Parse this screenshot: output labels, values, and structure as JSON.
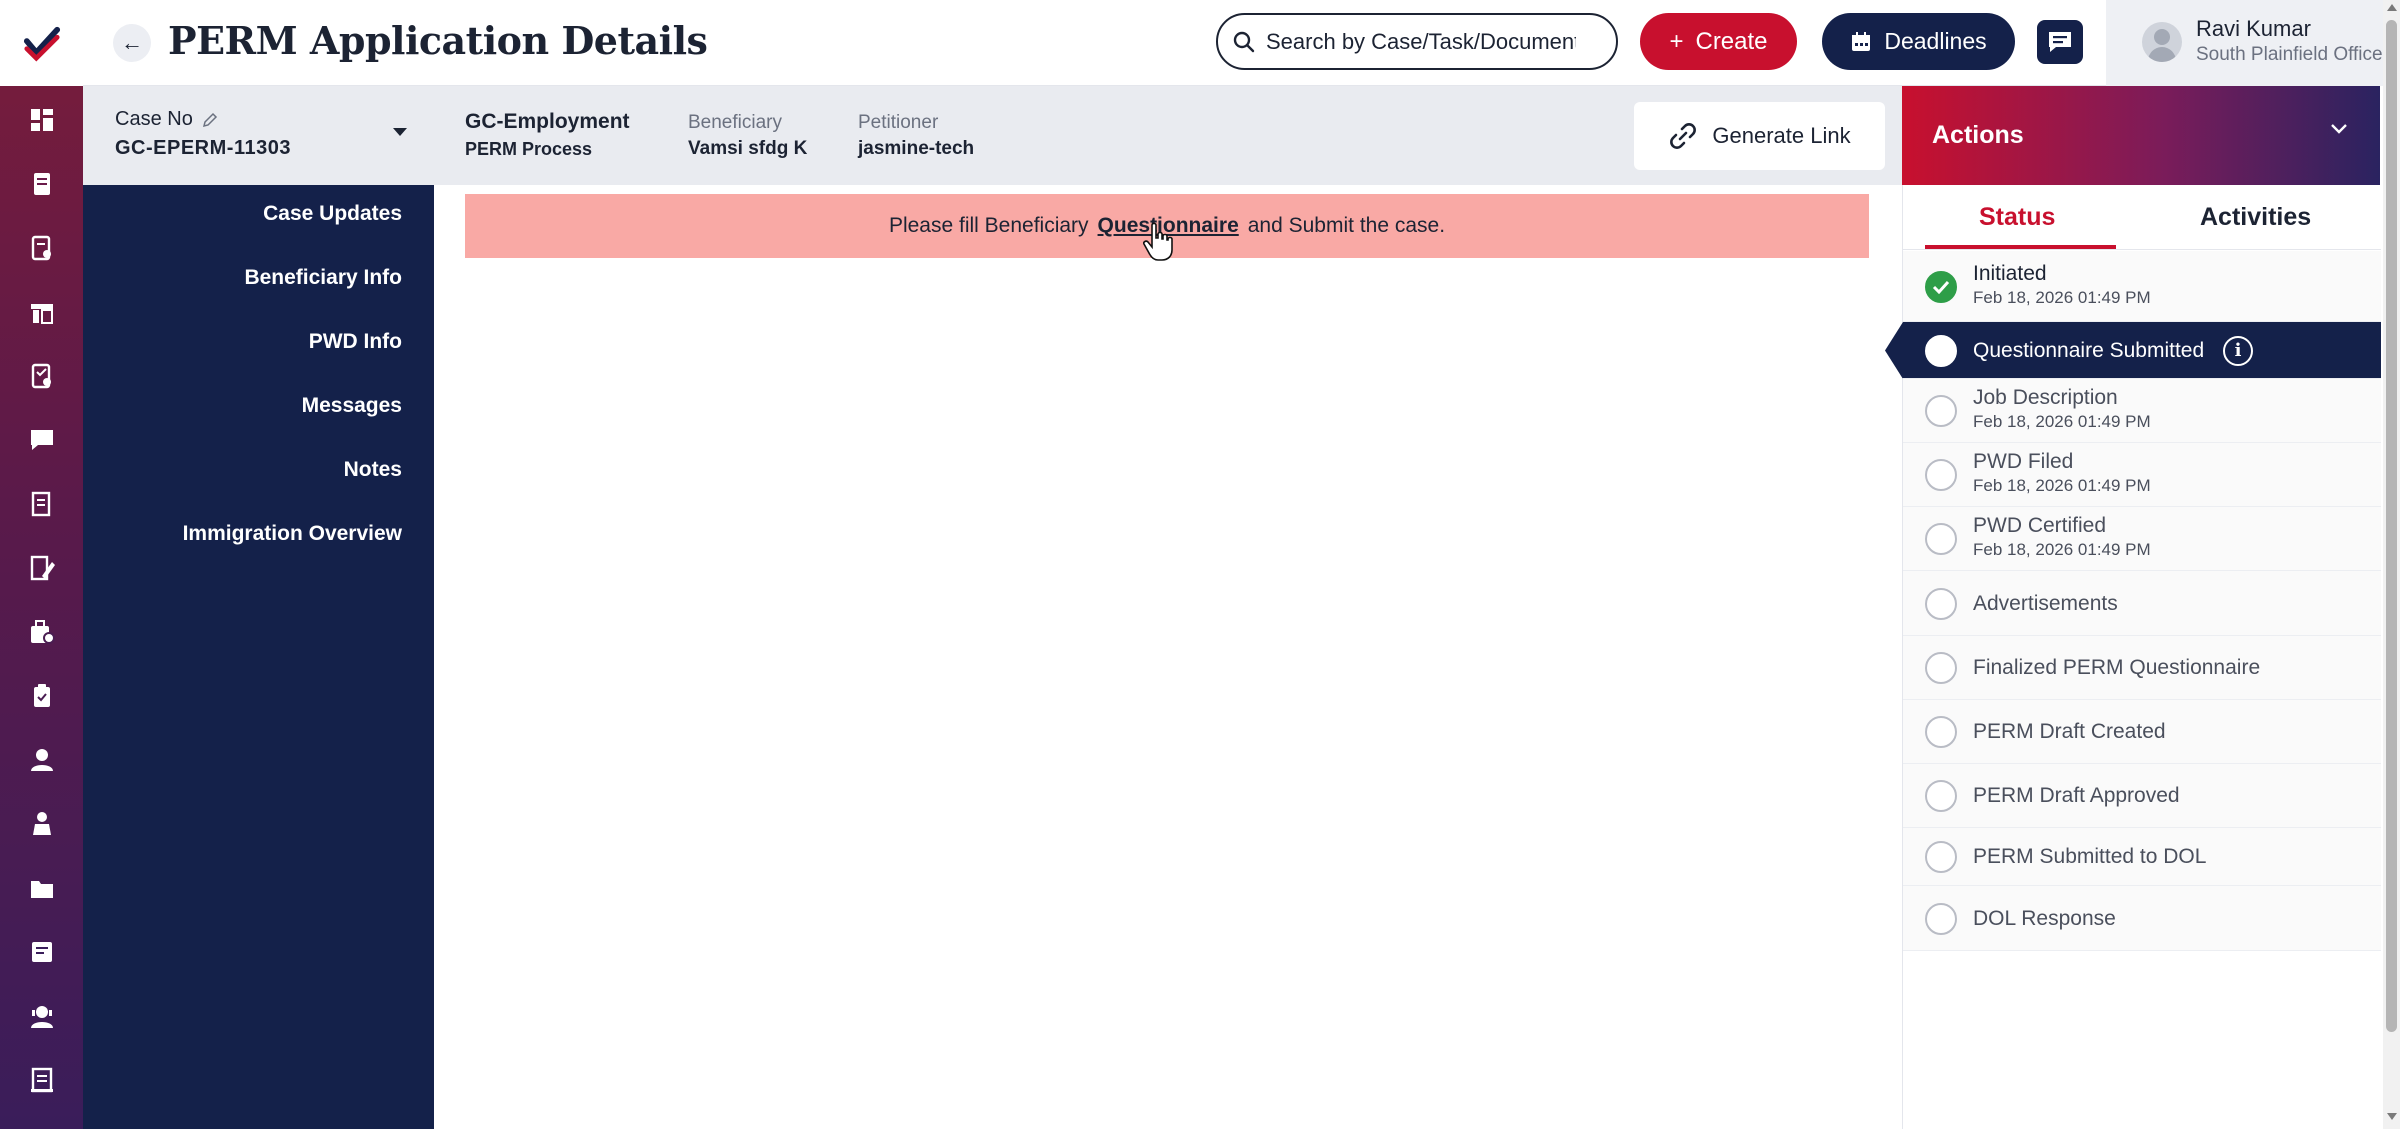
{
  "header": {
    "title": "PERM Application Details",
    "search_placeholder": "Search by Case/Task/Document",
    "create_label": "Create",
    "deadlines_label": "Deadlines"
  },
  "user": {
    "name": "Ravi Kumar",
    "office": "South Plainfield Office"
  },
  "case": {
    "case_no_label": "Case No",
    "case_no": "GC-EPERM-11303",
    "type": "GC-Employment",
    "process": "PERM Process",
    "beneficiary_label": "Beneficiary",
    "beneficiary": "Vamsi sfdg K",
    "petitioner_label": "Petitioner",
    "petitioner": "jasmine-tech",
    "generate_link_label": "Generate Link"
  },
  "sidenav": {
    "items": [
      {
        "label": "Case Updates"
      },
      {
        "label": "Beneficiary Info"
      },
      {
        "label": "PWD Info"
      },
      {
        "label": "Messages"
      },
      {
        "label": "Notes"
      },
      {
        "label": "Immigration Overview"
      }
    ]
  },
  "alert": {
    "before": "Please fill Beneficiary",
    "link": "Questionnaire",
    "after": "and Submit the case."
  },
  "actions": {
    "title": "Actions",
    "tabs": {
      "status": "Status",
      "activities": "Activities"
    },
    "steps": [
      {
        "title": "Initiated",
        "date": "Feb 18, 2026 01:49 PM",
        "state": "done"
      },
      {
        "title": "Questionnaire Submitted",
        "date": "",
        "state": "active"
      },
      {
        "title": "Job Description",
        "date": "Feb 18, 2026 01:49 PM",
        "state": "pending"
      },
      {
        "title": "PWD Filed",
        "date": "Feb 18, 2026 01:49 PM",
        "state": "pending"
      },
      {
        "title": "PWD Certified",
        "date": "Feb 18, 2026 01:49 PM",
        "state": "pending"
      },
      {
        "title": "Advertisements",
        "date": "",
        "state": "pending"
      },
      {
        "title": "Finalized PERM Questionnaire",
        "date": "",
        "state": "pending"
      },
      {
        "title": "PERM Draft Created",
        "date": "",
        "state": "pending"
      },
      {
        "title": "PERM Draft Approved",
        "date": "",
        "state": "pending"
      },
      {
        "title": "PERM Submitted to DOL",
        "date": "",
        "state": "pending"
      },
      {
        "title": "DOL Response",
        "date": "",
        "state": "pending"
      }
    ]
  },
  "rail_icons": [
    "dashboard-icon",
    "document-icon",
    "form-icon",
    "building-icon",
    "checklist-icon",
    "chat-icon",
    "ledger-icon",
    "edit-icon",
    "briefcase-icon",
    "clipboard-icon",
    "user-icon",
    "person-icon",
    "folder-icon",
    "note-icon",
    "support-icon",
    "book-icon"
  ],
  "colors": {
    "brand_red": "#c8102e",
    "navy": "#14214a",
    "alert_bg": "#f9a9a5",
    "success": "#2e9e48"
  }
}
